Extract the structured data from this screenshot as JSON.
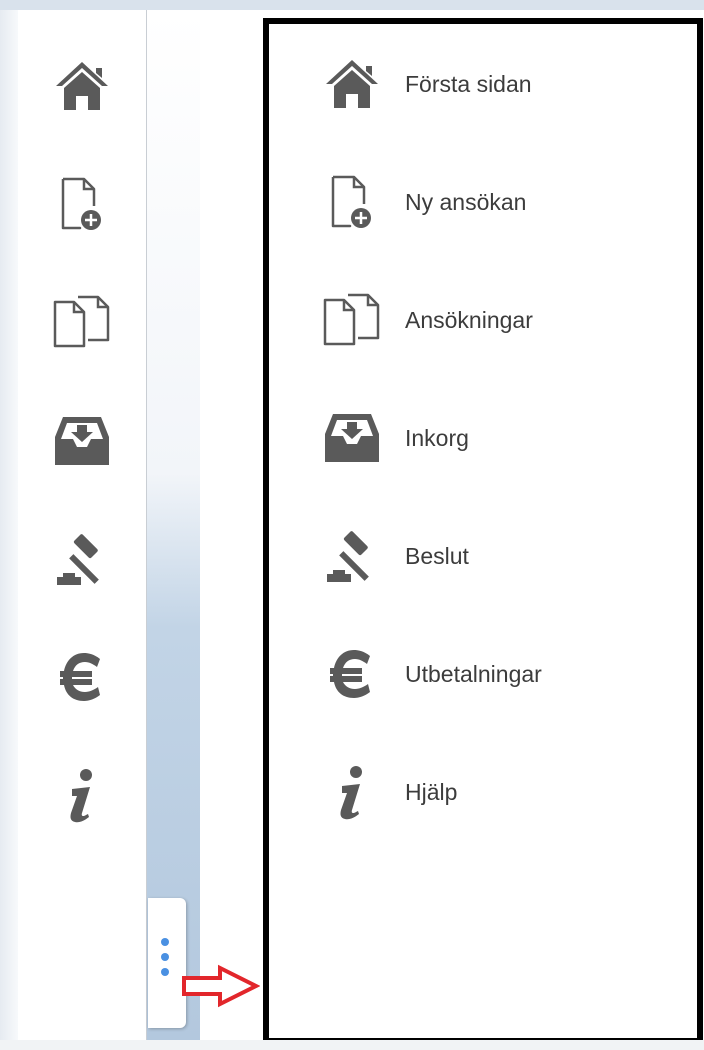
{
  "menu": {
    "items": [
      {
        "label": "Första sidan",
        "icon": "home-icon"
      },
      {
        "label": "Ny ansökan",
        "icon": "new-document-icon"
      },
      {
        "label": "Ansökningar",
        "icon": "documents-icon"
      },
      {
        "label": "Inkorg",
        "icon": "inbox-icon"
      },
      {
        "label": "Beslut",
        "icon": "gavel-icon"
      },
      {
        "label": "Utbetalningar",
        "icon": "euro-icon"
      },
      {
        "label": "Hjälp",
        "icon": "info-icon"
      }
    ]
  },
  "colors": {
    "icon": "#5a5a5a",
    "menu_text": "#3c3c3c",
    "highlight_border": "#000000",
    "annotation_arrow": "#e2262b",
    "grip_dots": "#4a90e2"
  }
}
